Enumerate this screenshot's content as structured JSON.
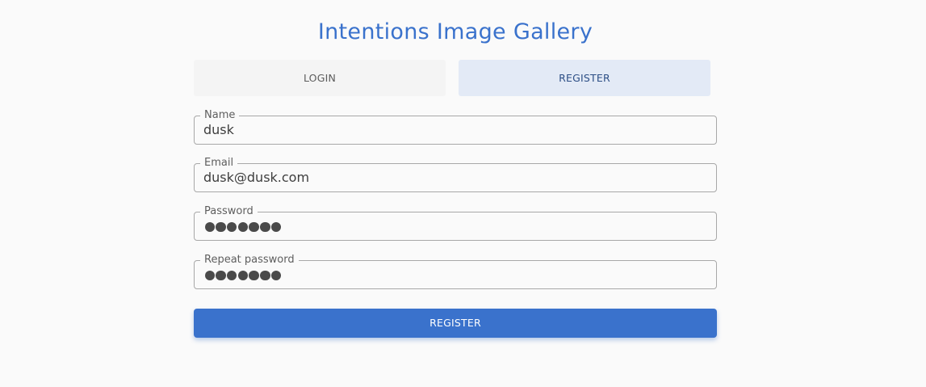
{
  "app": {
    "title": "Intentions Image Gallery"
  },
  "tabs": [
    {
      "label": "LOGIN",
      "active": false
    },
    {
      "label": "REGISTER",
      "active": true
    }
  ],
  "form": {
    "name": {
      "label": "Name",
      "value": "dusk"
    },
    "email": {
      "label": "Email",
      "value": "dusk@dusk.com"
    },
    "password": {
      "label": "Password",
      "masked_length": 7
    },
    "repeat_password": {
      "label": "Repeat password",
      "masked_length": 7
    },
    "submit_label": "REGISTER"
  },
  "colors": {
    "accent": "#3a72cc",
    "active_tab_bg": "#e3eaf6",
    "inactive_tab_bg": "#f4f4f4",
    "background": "#fafafa"
  }
}
